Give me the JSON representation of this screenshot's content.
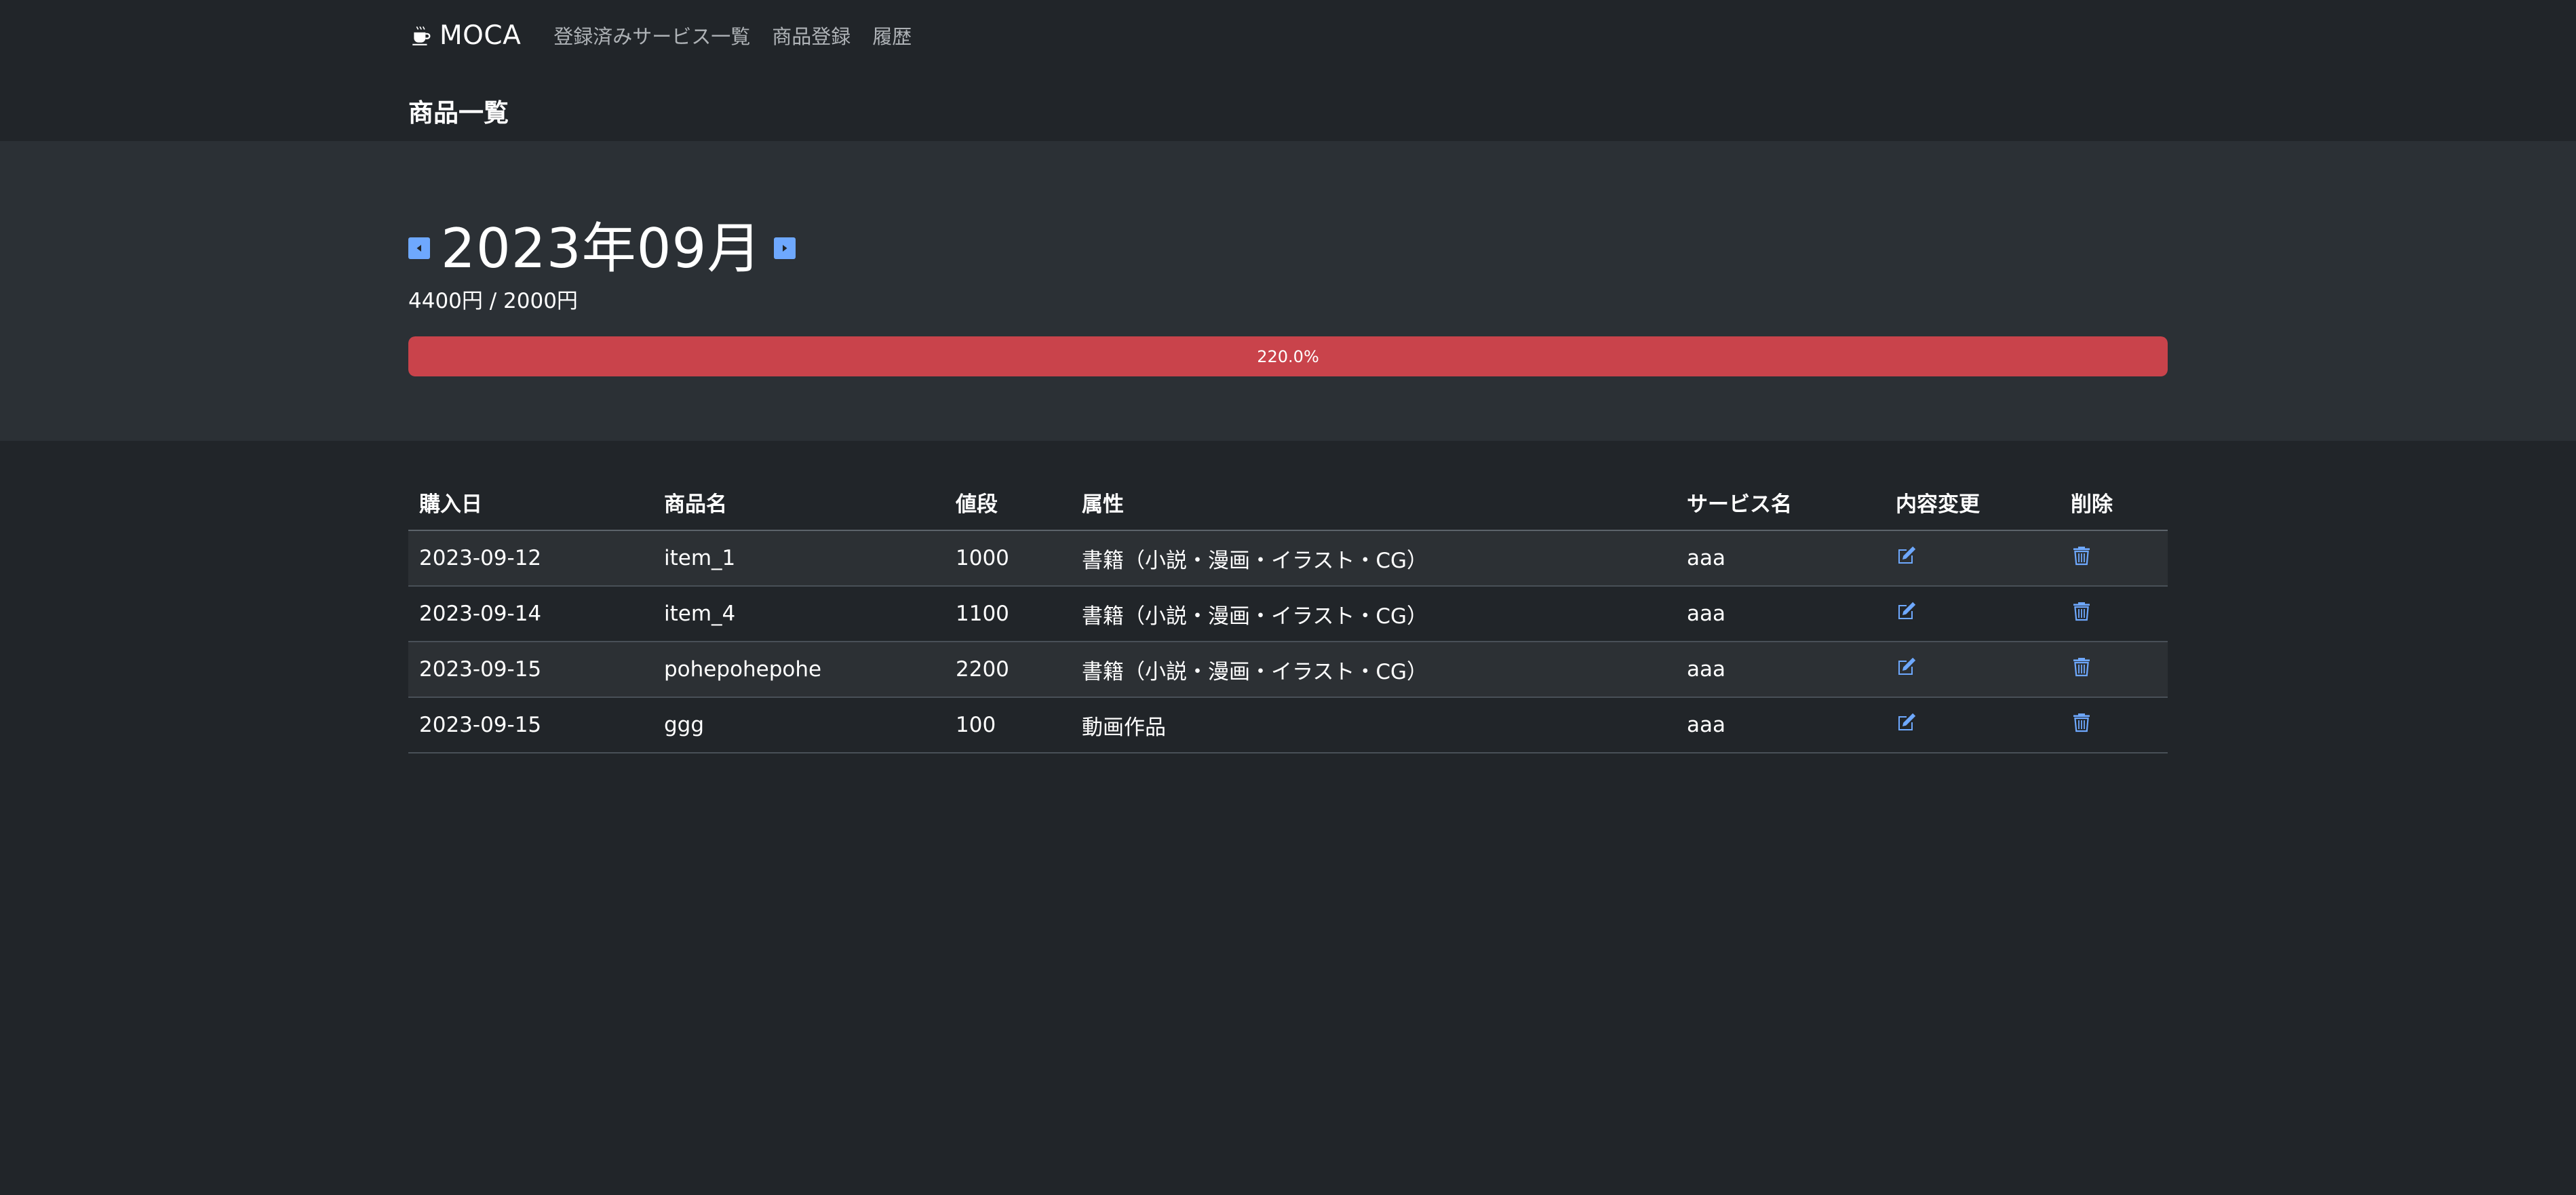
{
  "navbar": {
    "brand": "MOCA",
    "links": [
      {
        "label": "登録済みサービス一覧"
      },
      {
        "label": "商品登録"
      },
      {
        "label": "履歴"
      }
    ]
  },
  "page": {
    "title": "商品一覧"
  },
  "summary": {
    "month": "2023年09月",
    "budget_text": "4400円 / 2000円",
    "progress_percent": 220.0,
    "progress_label": "220.0%"
  },
  "table": {
    "headers": [
      "購入日",
      "商品名",
      "値段",
      "属性",
      "サービス名",
      "内容変更",
      "削除"
    ],
    "rows": [
      {
        "date": "2023-09-12",
        "name": "item_1",
        "price": "1000",
        "attr": "書籍（小説・漫画・イラスト・CG）",
        "service": "aaa"
      },
      {
        "date": "2023-09-14",
        "name": "item_4",
        "price": "1100",
        "attr": "書籍（小説・漫画・イラスト・CG）",
        "service": "aaa"
      },
      {
        "date": "2023-09-15",
        "name": "pohepohepohe",
        "price": "2200",
        "attr": "書籍（小説・漫画・イラスト・CG）",
        "service": "aaa"
      },
      {
        "date": "2023-09-15",
        "name": "ggg",
        "price": "100",
        "attr": "動画作品",
        "service": "aaa"
      }
    ]
  },
  "colors": {
    "background": "#212529",
    "hero": "#2b3035",
    "danger": "#c9434b",
    "accent": "#6ea8fe"
  },
  "icons": {
    "brand": "coffee-cup-icon",
    "prev": "caret-left-square-icon",
    "next": "caret-right-square-icon",
    "edit": "pencil-square-icon",
    "delete": "trash-icon"
  }
}
